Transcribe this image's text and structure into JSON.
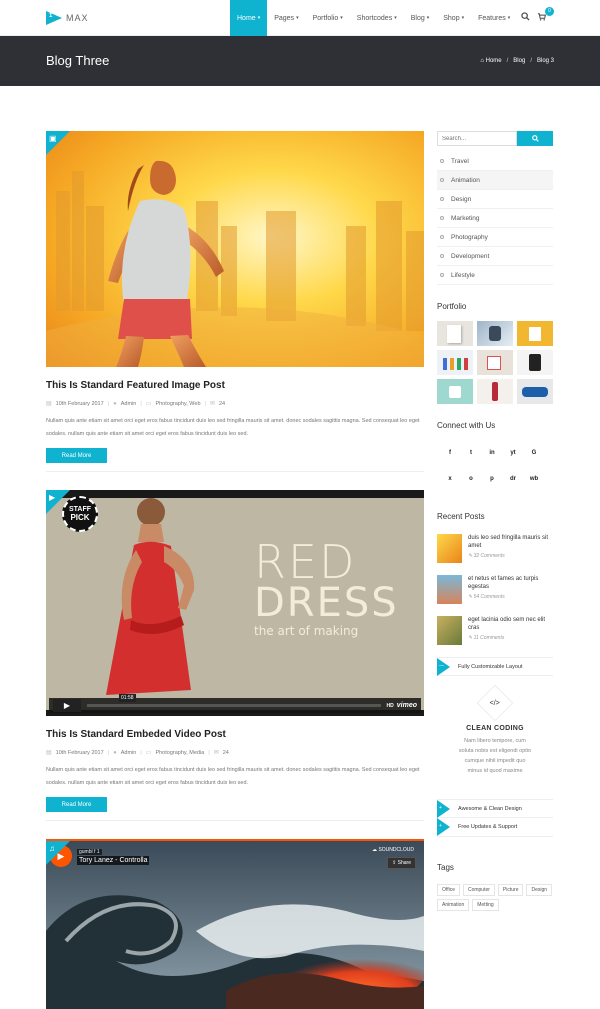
{
  "brand": {
    "mark": "1",
    "name": "MAX"
  },
  "nav": {
    "items": [
      {
        "label": "Home",
        "active": true
      },
      {
        "label": "Pages"
      },
      {
        "label": "Portfolio"
      },
      {
        "label": "Shortcodes"
      },
      {
        "label": "Blog"
      },
      {
        "label": "Shop"
      },
      {
        "label": "Features"
      }
    ],
    "cart_count": "0"
  },
  "header": {
    "title": "Blog Three",
    "breadcrumb": [
      "Home",
      "Blog",
      "Blog 3"
    ],
    "separator": "/"
  },
  "posts": [
    {
      "title": "This Is Standard Featured Image Post",
      "date": "10th February 2017",
      "author": "Admin",
      "categories": "Photography, Web",
      "comments": "24",
      "excerpt": "Nullam quis ante etiam sit amet orci eget eros fabus tincidunt duis leo sed fringilla mauris sit amet. donec sodales sagittis magna. Sed consequat leo eget sodales. nullam quis ante etiam sit amet orci eget eros fabus tincidunt duis leo sed.",
      "button": "Read More"
    },
    {
      "title": "This Is Standard Embeded Video Post",
      "date": "10th February 2017",
      "author": "Admin",
      "categories": "Photography, Media",
      "comments": "24",
      "excerpt": "Nullam quis ante etiam sit amet orci eget eros fabus tincidunt duis leo sed fringilla mauris sit amet. donec sodales sagittis magna. Sed consequat leo eget sodales. nullam quis ante etiam sit amet orci eget eros fabus tincidunt duis leo sed.",
      "button": "Read More",
      "video": {
        "poster_line1": "RED",
        "poster_line2": "DRESS",
        "poster_line3": "the art of making",
        "badge_top": "STAFF",
        "badge_bottom": "PICK",
        "time": "01:58",
        "hd": "HD",
        "provider": "vimeo"
      }
    },
    {
      "audio": {
        "user": "gumbl f 1",
        "track": "Tory Lanez - Controlla",
        "brand": "SOUNDCLOUD",
        "share": "Share"
      }
    }
  ],
  "sidebar": {
    "search_placeholder": "Search...",
    "categories": [
      "Travel",
      "Animation",
      "Design",
      "Marketing",
      "Photography",
      "Development",
      "Lifestyle"
    ],
    "portfolio_title": "Portfolio",
    "connect_title": "Connect with Us",
    "social": [
      "f",
      "t",
      "in",
      "yt",
      "G",
      "x",
      "o",
      "p",
      "dr",
      "wb"
    ],
    "recent_title": "Recent Posts",
    "recent": [
      {
        "title": "duis leo sed fringilla mauris sit amet",
        "comments": "32 Comments"
      },
      {
        "title": "et netus et fames ac turpis egestas",
        "comments": "54 Comments"
      },
      {
        "title": "eget lacinia odio sem nec elit cras",
        "comments": "11 Comments"
      }
    ],
    "features": [
      "Fully Customizable Layout",
      "Awesome & Clean Design",
      "Free Updates & Support"
    ],
    "coding": {
      "icon": "</>",
      "title": "CLEAN CODING",
      "text": "Nam libero tempore, cum soluta nobis est eligendi optio cumque nihil impedit quo minus id quod maxime"
    },
    "tags_title": "Tags",
    "tags": [
      "Office",
      "Computer",
      "Picture",
      "Design",
      "Animation",
      "Metting"
    ]
  },
  "colors": {
    "accent": "#0fb2cf",
    "header_bg": "#2e3035"
  }
}
